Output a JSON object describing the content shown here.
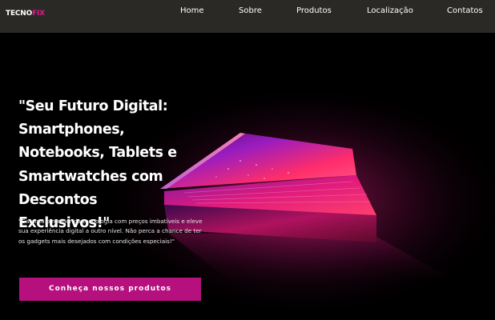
{
  "brand": {
    "name_main": "TECNO",
    "name_accent": "FIX",
    "accent_color": "#e0178f"
  },
  "nav": {
    "items": [
      {
        "label": "Home"
      },
      {
        "label": "Sobre"
      },
      {
        "label": "Produtos"
      },
      {
        "label": "Localização"
      },
      {
        "label": "Contatos"
      }
    ]
  },
  "hero": {
    "headline": "\"Seu Futuro Digital: Smartphones, Notebooks, Tablets e Smartwatches com Descontos Exclusivos!\"",
    "subtext": "\"Garanta o melhor da tecnologia com preços imbatíveis e eleve sua experiência digital a outro nível. Não perca a chance de ter os gadgets mais desejados com condições especiais!\"",
    "cta_label": "Conheça nossos produtos",
    "cta_color": "#b5107e"
  }
}
